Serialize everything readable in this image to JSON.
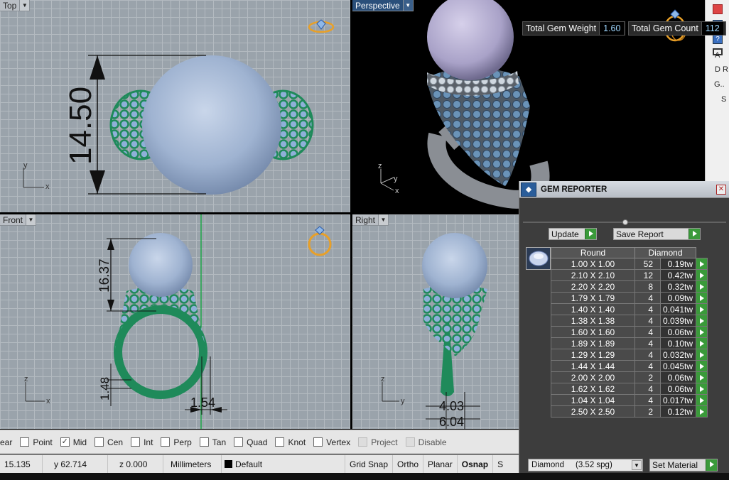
{
  "viewports": {
    "top": {
      "label": "Top",
      "dim_text": "14.50"
    },
    "perspective": {
      "label": "Perspective"
    },
    "front": {
      "label": "Front",
      "dim_height": "16.37",
      "dim_small": "1.48",
      "dim_bottom": "1.54"
    },
    "right": {
      "label": "Right",
      "dim_a": "4.03",
      "dim_b": "6.04"
    }
  },
  "axes": {
    "x": "x",
    "y": "y",
    "z": "z"
  },
  "osnap": {
    "items": [
      {
        "label": "ear",
        "checked": false,
        "has_box": false
      },
      {
        "label": "Point",
        "checked": false
      },
      {
        "label": "Mid",
        "checked": true
      },
      {
        "label": "Cen",
        "checked": false
      },
      {
        "label": "Int",
        "checked": false
      },
      {
        "label": "Perp",
        "checked": false
      },
      {
        "label": "Tan",
        "checked": false
      },
      {
        "label": "Quad",
        "checked": false
      },
      {
        "label": "Knot",
        "checked": false
      },
      {
        "label": "Vertex",
        "checked": false
      },
      {
        "label": "Project",
        "checked": false,
        "disabled": true
      },
      {
        "label": "Disable",
        "checked": false,
        "disabled": true
      }
    ]
  },
  "status": {
    "x": "15.135",
    "y": "y 62.714",
    "z": "z 0.000",
    "units": "Millimeters",
    "layer": "Default",
    "grid_snap": "Grid Snap",
    "ortho": "Ortho",
    "planar": "Planar",
    "osnap": "Osnap",
    "s": "S"
  },
  "right_toolbar": {
    "a": "A",
    "d": "D",
    "g": "G..",
    "s": "S",
    "r": "R"
  },
  "gem_reporter": {
    "title": "GEM REPORTER",
    "total_weight_label": "Total Gem Weight",
    "total_weight": "1.60",
    "total_count_label": "Total Gem Count",
    "total_count": "112",
    "update_label": "Update",
    "save_label": "Save Report",
    "col_shape": "Round",
    "col_material": "Diamond",
    "rows": [
      {
        "size": "1.00 X 1.00",
        "count": "52",
        "weight": "0.19tw"
      },
      {
        "size": "2.10 X 2.10",
        "count": "12",
        "weight": "0.42tw"
      },
      {
        "size": "2.20 X 2.20",
        "count": "8",
        "weight": "0.32tw"
      },
      {
        "size": "1.79 X 1.79",
        "count": "4",
        "weight": "0.09tw"
      },
      {
        "size": "1.40 X 1.40",
        "count": "4",
        "weight": "0.041tw"
      },
      {
        "size": "1.38 X 1.38",
        "count": "4",
        "weight": "0.039tw"
      },
      {
        "size": "1.60 X 1.60",
        "count": "4",
        "weight": "0.06tw"
      },
      {
        "size": "1.89 X 1.89",
        "count": "4",
        "weight": "0.10tw"
      },
      {
        "size": "1.29 X 1.29",
        "count": "4",
        "weight": "0.032tw"
      },
      {
        "size": "1.44 X 1.44",
        "count": "4",
        "weight": "0.045tw"
      },
      {
        "size": "2.00 X 2.00",
        "count": "2",
        "weight": "0.06tw"
      },
      {
        "size": "1.62 X 1.62",
        "count": "4",
        "weight": "0.06tw"
      },
      {
        "size": "1.04 X 1.04",
        "count": "4",
        "weight": "0.017tw"
      },
      {
        "size": "2.50 X 2.50",
        "count": "2",
        "weight": "0.12tw"
      }
    ],
    "material_value": "Diamond     (3.52 spg)",
    "set_material_label": "Set Material"
  },
  "colors": {
    "pearl": "#9fb3d1",
    "metal": "#1f8a5a",
    "perspective_bg": "#000000",
    "gem_panel": "#3d3d3d"
  }
}
